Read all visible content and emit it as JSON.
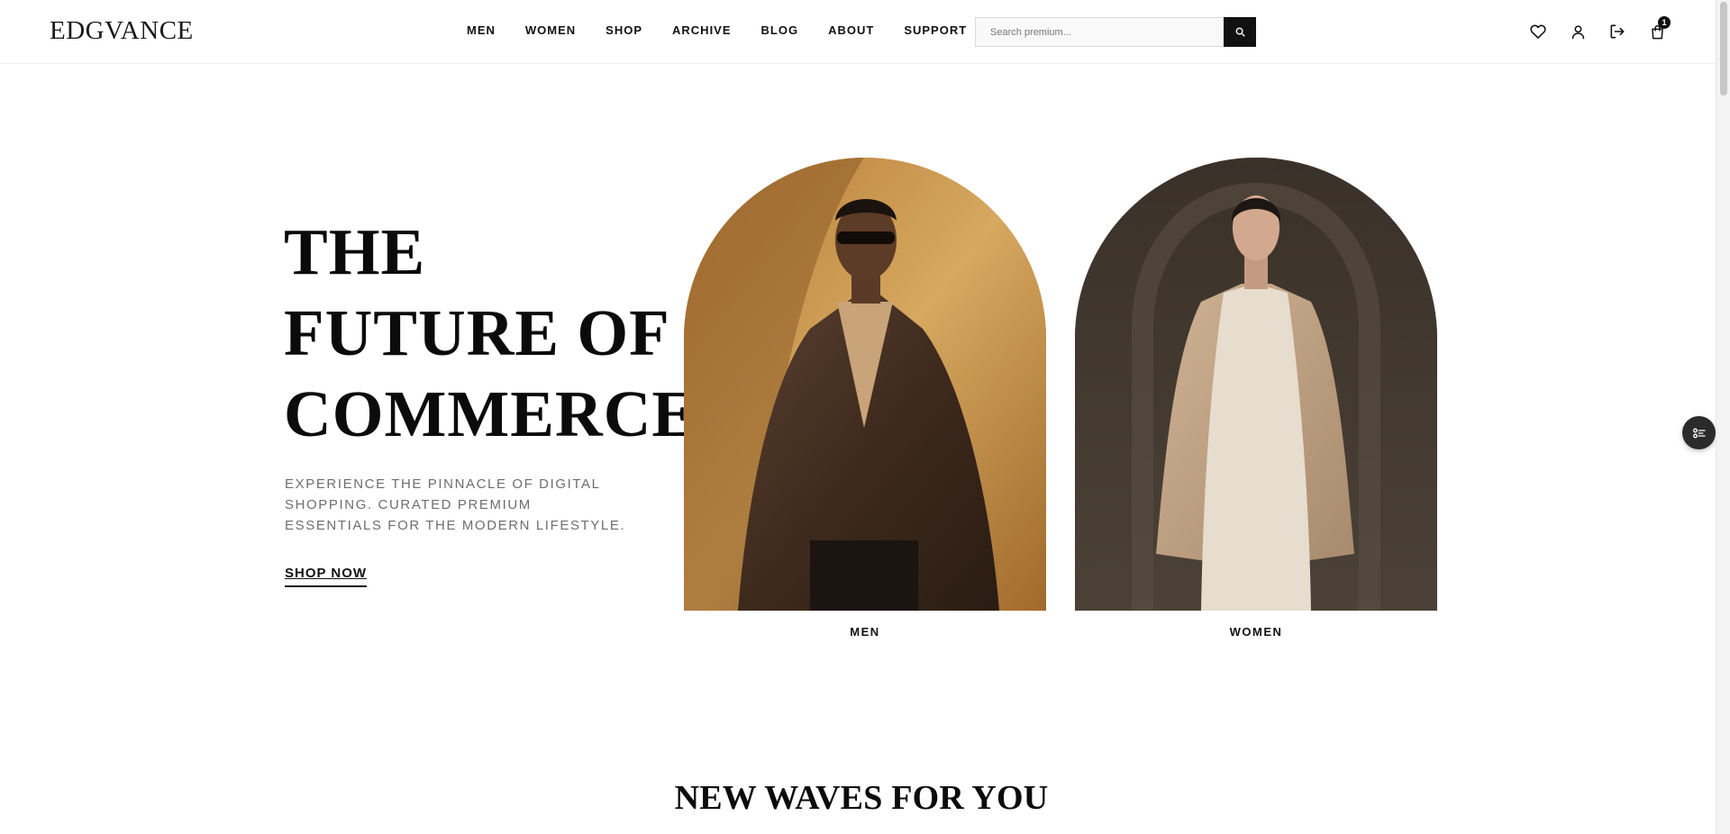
{
  "brand": {
    "logo": "EDGVANCE"
  },
  "nav": {
    "items": [
      "MEN",
      "WOMEN",
      "SHOP",
      "ARCHIVE",
      "BLOG",
      "ABOUT",
      "SUPPORT"
    ]
  },
  "search": {
    "placeholder": "Search premium...",
    "value": ""
  },
  "header_icons": {
    "wishlist": "heart-icon",
    "account": "user-icon",
    "logout": "logout-icon",
    "cart": "shopping-bag-icon",
    "cart_count": "1"
  },
  "hero": {
    "title_lines": [
      "THE",
      "FUTURE OF",
      "COMMERCE"
    ],
    "description": "EXPERIENCE THE PINNACLE OF DIGITAL SHOPPING. CURATED PREMIUM ESSENTIALS FOR THE MODERN LIFESTYLE.",
    "cta": "SHOP NOW"
  },
  "categories": [
    {
      "label": "MEN",
      "accent": "#b5813d"
    },
    {
      "label": "WOMEN",
      "accent": "#433a32"
    }
  ],
  "floating_button": {
    "icon": "filter-list-icon"
  },
  "section": {
    "title": "NEW WAVES FOR YOU"
  }
}
